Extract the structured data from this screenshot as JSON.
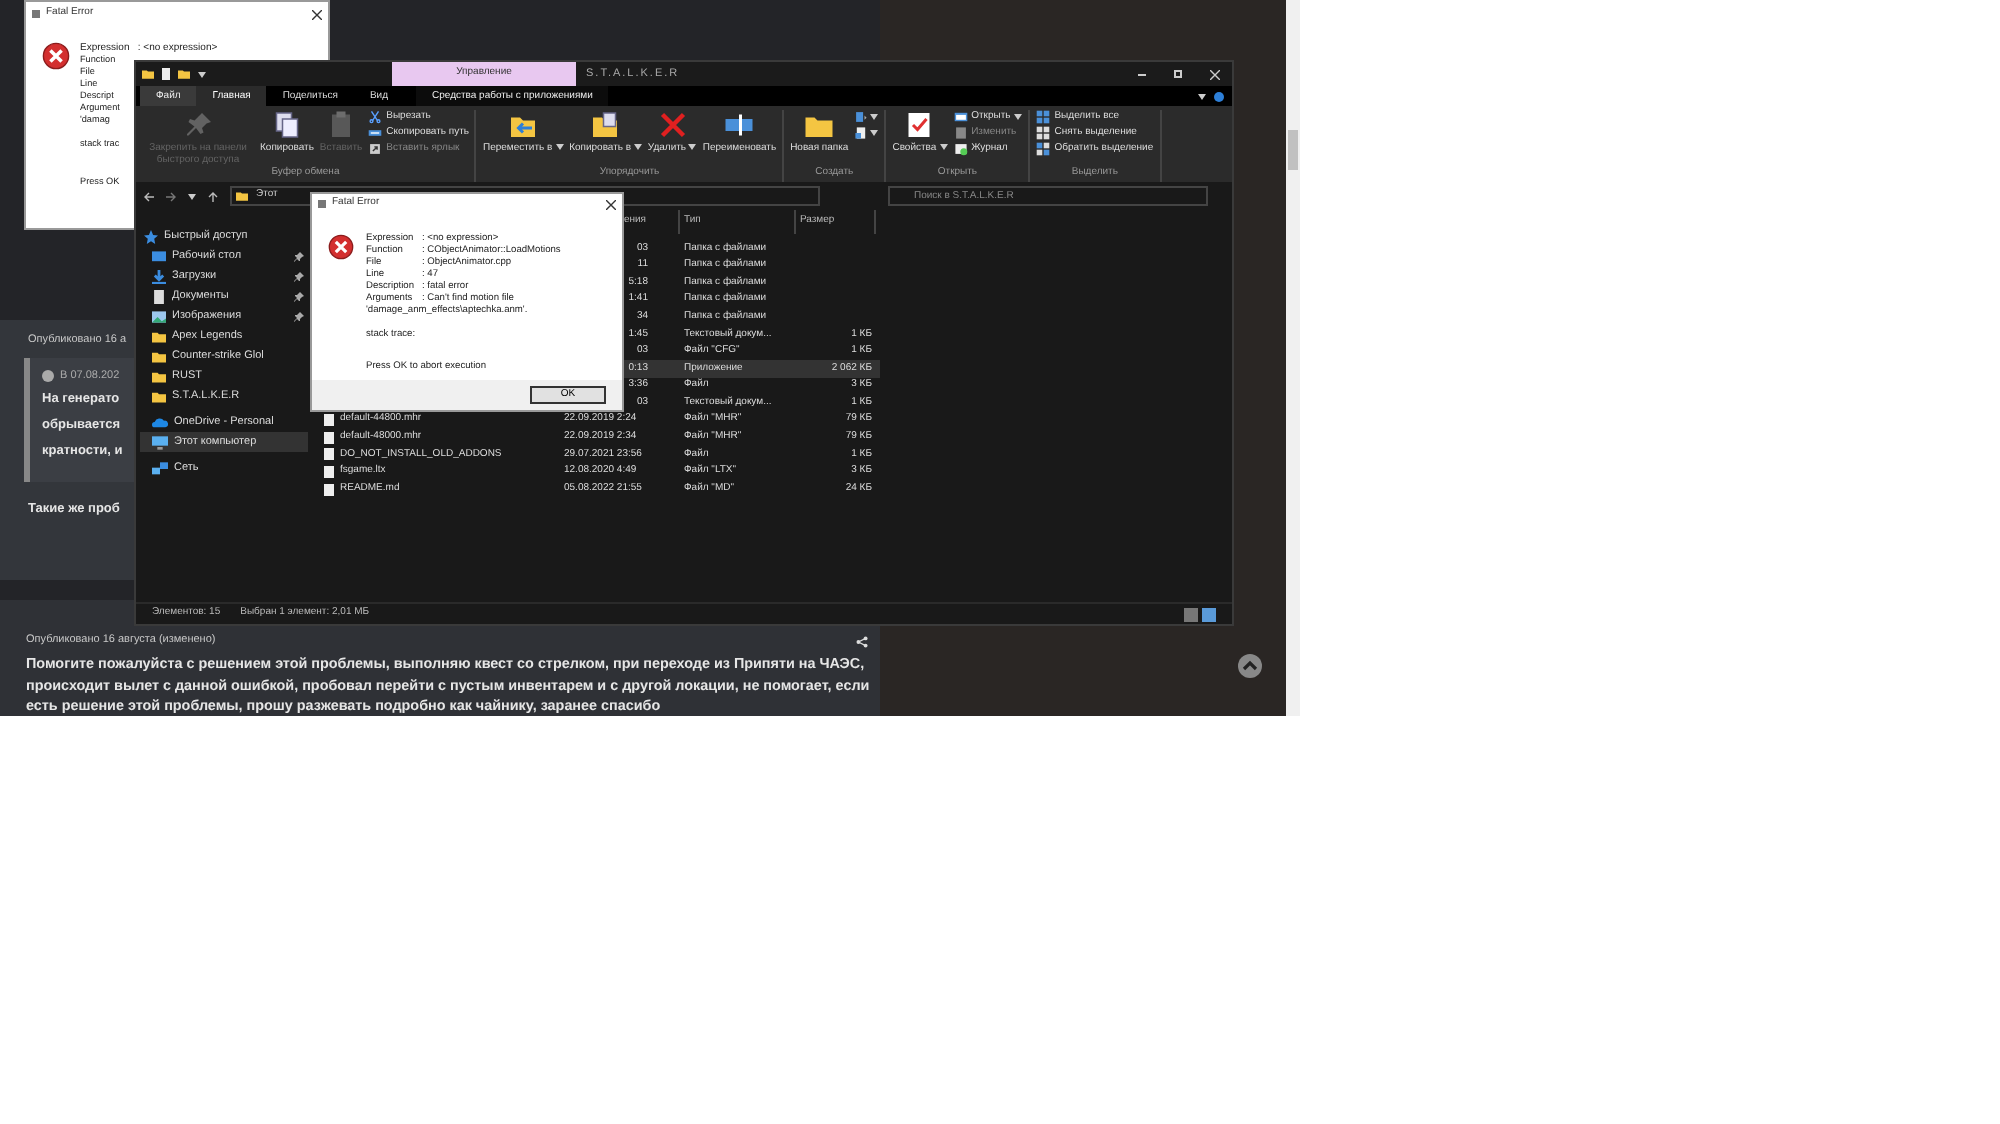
{
  "forum": {
    "post_1": {
      "meta": "Опубликовано 16 а",
      "quote": {
        "author": "В 07.08.202",
        "lines": [
          "На генерато",
          "обрывается",
          "кратности, и"
        ]
      },
      "text": "Такие же проб"
    },
    "post_2": {
      "meta": "Опубликовано 16 августа (изменено)",
      "text": "Помогите пожалуйста с решением этой проблемы, выполняю квест со стрелком, при переходе из Припяти на ЧАЭС, происходит вылет с данной ошибкой, пробовал перейти с пустым инвентарем и с другой локации, не помогает, если есть решение этой проблемы, прошу разжевать подробно как чайнику, заранее спасибо"
    }
  },
  "back_dialog": {
    "title": "Fatal Error",
    "first_line": "Expression   : <no expression>",
    "lines": [
      "Function",
      "File",
      "Line",
      "Descript",
      "Argument",
      "'damag"
    ],
    "stack": "stack trac",
    "press": "Press OK"
  },
  "explorer": {
    "context_tab": "Управление",
    "title": "S.T.A.L.K.E.R",
    "tabs": [
      {
        "label": "Файл",
        "selected": false,
        "kind": "file"
      },
      {
        "label": "Главная",
        "selected": true,
        "kind": "tab"
      },
      {
        "label": "Поделиться",
        "selected": false,
        "kind": "tab"
      },
      {
        "label": "Вид",
        "selected": false,
        "kind": "tab"
      },
      {
        "label": "Средства работы с приложениями",
        "selected": false,
        "kind": "context"
      }
    ],
    "ribbon": [
      {
        "name": "Буфер обмена",
        "items": [
          {
            "label": "Закрепить на панели быстрого доступа",
            "kind": "pin",
            "disabled": true
          },
          {
            "label": "Копировать",
            "kind": "copy",
            "disabled": false
          },
          {
            "label": "Вставить",
            "kind": "paste",
            "disabled": true
          },
          {
            "label": "Вырезать",
            "kind": "cut",
            "disabled": false
          },
          {
            "label": "Скопировать путь",
            "kind": "path",
            "disabled": false
          },
          {
            "label": "Вставить ярлык",
            "kind": "shortcut",
            "disabled": true
          }
        ]
      },
      {
        "name": "Упорядочить",
        "items": [
          {
            "label": "Переместить в",
            "kind": "move",
            "disabled": false,
            "menu": true
          },
          {
            "label": "Копировать в",
            "kind": "copyto",
            "disabled": false,
            "menu": true
          },
          {
            "label": "Удалить",
            "kind": "delete",
            "disabled": false,
            "menu": true
          },
          {
            "label": "Переименовать",
            "kind": "rename",
            "disabled": false
          }
        ]
      },
      {
        "name": "Создать",
        "items": [
          {
            "label": "Новая папка",
            "kind": "newfolder",
            "disabled": false
          },
          {
            "kind": "newitem",
            "disabled": false,
            "menu": true
          },
          {
            "kind": "easy",
            "disabled": false,
            "menu": true
          }
        ]
      },
      {
        "name": "Открыть",
        "items": [
          {
            "label": "Свойства",
            "kind": "properties",
            "disabled": false,
            "menu": true
          },
          {
            "label": "Открыть",
            "kind": "open",
            "disabled": false,
            "menu": true
          },
          {
            "label": "Изменить",
            "kind": "edit",
            "disabled": true
          },
          {
            "label": "Журнал",
            "kind": "history",
            "disabled": false
          }
        ]
      },
      {
        "name": "Выделить",
        "items": [
          {
            "label": "Выделить все",
            "kind": "selectall",
            "disabled": false
          },
          {
            "label": "Снять выделение",
            "kind": "selectnone",
            "disabled": false
          },
          {
            "label": "Обратить выделение",
            "kind": "invert",
            "disabled": false
          }
        ]
      }
    ],
    "address": "Этот",
    "search_placeholder": "Поиск в S.T.A.L.K.E.R",
    "nav": [
      {
        "label": "Быстрый доступ",
        "kind": "star",
        "pinned": false,
        "selected": false
      },
      {
        "label": "Рабочий стол",
        "kind": "desktop",
        "pinned": true,
        "selected": false
      },
      {
        "label": "Загрузки",
        "kind": "download",
        "pinned": true,
        "selected": false
      },
      {
        "label": "Документы",
        "kind": "document",
        "pinned": true,
        "selected": false
      },
      {
        "label": "Изображения",
        "kind": "picture",
        "pinned": true,
        "selected": false
      },
      {
        "label": "Apex Legends",
        "kind": "folder",
        "pinned": false,
        "selected": false
      },
      {
        "label": "Counter-strike Glol",
        "kind": "folder",
        "pinned": false,
        "selected": false
      },
      {
        "label": "RUST",
        "kind": "folder",
        "pinned": false,
        "selected": false
      },
      {
        "label": "S.T.A.L.K.E.R",
        "kind": "folder",
        "pinned": false,
        "selected": false
      },
      {
        "label": "OneDrive - Personal",
        "kind": "cloud",
        "pinned": false,
        "selected": false
      },
      {
        "label": "Этот компьютер",
        "kind": "computer",
        "pinned": false,
        "selected": true
      },
      {
        "label": "Сеть",
        "kind": "network",
        "pinned": false,
        "selected": false
      }
    ],
    "columns": [
      {
        "label": "ения",
        "partial": true
      },
      {
        "label": "Тип",
        "partial": false
      },
      {
        "label": "Размер",
        "partial": false
      }
    ],
    "files": [
      {
        "date": "03",
        "date_partial": true,
        "type": "Папка с файлами",
        "selected": false
      },
      {
        "date": "11",
        "date_partial": true,
        "type": "Папка с файлами",
        "selected": false
      },
      {
        "date": "5:18",
        "date_partial": true,
        "type": "Папка с файлами",
        "selected": false
      },
      {
        "date": "1:41",
        "date_partial": true,
        "type": "Папка с файлами",
        "selected": false
      },
      {
        "date": "34",
        "date_partial": true,
        "type": "Папка с файлами",
        "selected": false
      },
      {
        "date": "1:45",
        "date_partial": true,
        "type": "Текстовый докум...",
        "size": "1 КБ",
        "selected": false
      },
      {
        "date": "03",
        "date_partial": true,
        "type": "Файл \"CFG\"",
        "size": "1 КБ",
        "selected": false
      },
      {
        "date": "0:13",
        "date_partial": true,
        "type": "Приложение",
        "size": "2 062 КБ",
        "selected": true
      },
      {
        "date": "3:36",
        "date_partial": true,
        "type": "Файл",
        "size": "3 КБ",
        "selected": false
      },
      {
        "date": "03",
        "date_partial": true,
        "type": "Текстовый докум...",
        "size": "1 КБ",
        "selected": false
      },
      {
        "name": "default-44800.mhr",
        "date": "22.09.2019 2:24",
        "date_partial": false,
        "type": "Файл \"MHR\"",
        "size": "79 КБ",
        "selected": false
      },
      {
        "name": "default-48000.mhr",
        "date": "22.09.2019 2:34",
        "date_partial": false,
        "type": "Файл \"MHR\"",
        "size": "79 КБ",
        "selected": false
      },
      {
        "name": "DO_NOT_INSTALL_OLD_ADDONS",
        "date": "29.07.2021 23:56",
        "date_partial": false,
        "type": "Файл",
        "size": "1 КБ",
        "selected": false
      },
      {
        "name": "fsgame.ltx",
        "date": "12.08.2020 4:49",
        "date_partial": false,
        "type": "Файл \"LTX\"",
        "size": "3 КБ",
        "selected": false
      },
      {
        "name": "README.md",
        "date": "05.08.2022 21:55",
        "date_partial": false,
        "type": "Файл \"MD\"",
        "size": "24 КБ",
        "selected": false
      }
    ],
    "status": [
      "Элементов: 15",
      "Выбран 1 элемент: 2,01 МБ"
    ]
  },
  "dialog": {
    "title": "Fatal Error",
    "fields": [
      {
        "label": "Expression",
        "value": ": <no expression>"
      },
      {
        "label": "Function",
        "value": ": CObjectAnimator::LoadMotions"
      },
      {
        "label": "File",
        "value": ": ObjectAnimator.cpp"
      },
      {
        "label": "Line",
        "value": ": 47"
      },
      {
        "label": "Description",
        "value": ": fatal error"
      },
      {
        "label": "Arguments",
        "value": ": Can't find motion file"
      }
    ],
    "continuation": "'damage_anm_effects\\aptechka.anm'.",
    "stack": "stack trace:",
    "press": "Press OK to abort execution",
    "button": "OK"
  }
}
